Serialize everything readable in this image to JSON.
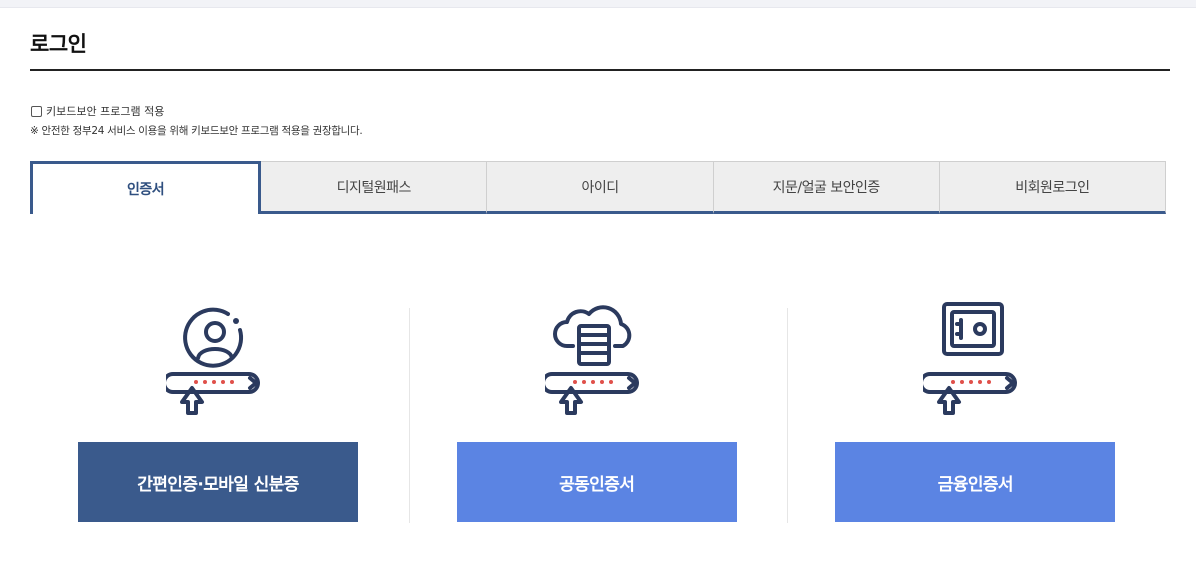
{
  "header": {
    "title": "로그인"
  },
  "security": {
    "checkbox_label": "키보드보안 프로그램 적용",
    "notice": "※ 안전한 정부24 서비스 이용을 위해 키보드보안 프로그램 적용을 권장합니다."
  },
  "tabs": [
    {
      "label": "인증서",
      "active": true
    },
    {
      "label": "디지털원패스",
      "active": false
    },
    {
      "label": "아이디",
      "active": false
    },
    {
      "label": "지문/얼굴 보안인증",
      "active": false
    },
    {
      "label": "비회원로그인",
      "active": false
    }
  ],
  "cards": [
    {
      "icon": "user-certificate-icon",
      "button_label": "간편인증·모바일 신분증"
    },
    {
      "icon": "cloud-server-certificate-icon",
      "button_label": "공동인증서"
    },
    {
      "icon": "safe-certificate-icon",
      "button_label": "금융인증서"
    }
  ],
  "colors": {
    "primary_dark": "#3a5a8c",
    "primary_light": "#5b84e3",
    "icon_navy": "#2b3a5e",
    "icon_dot_red": "#e0504a"
  }
}
